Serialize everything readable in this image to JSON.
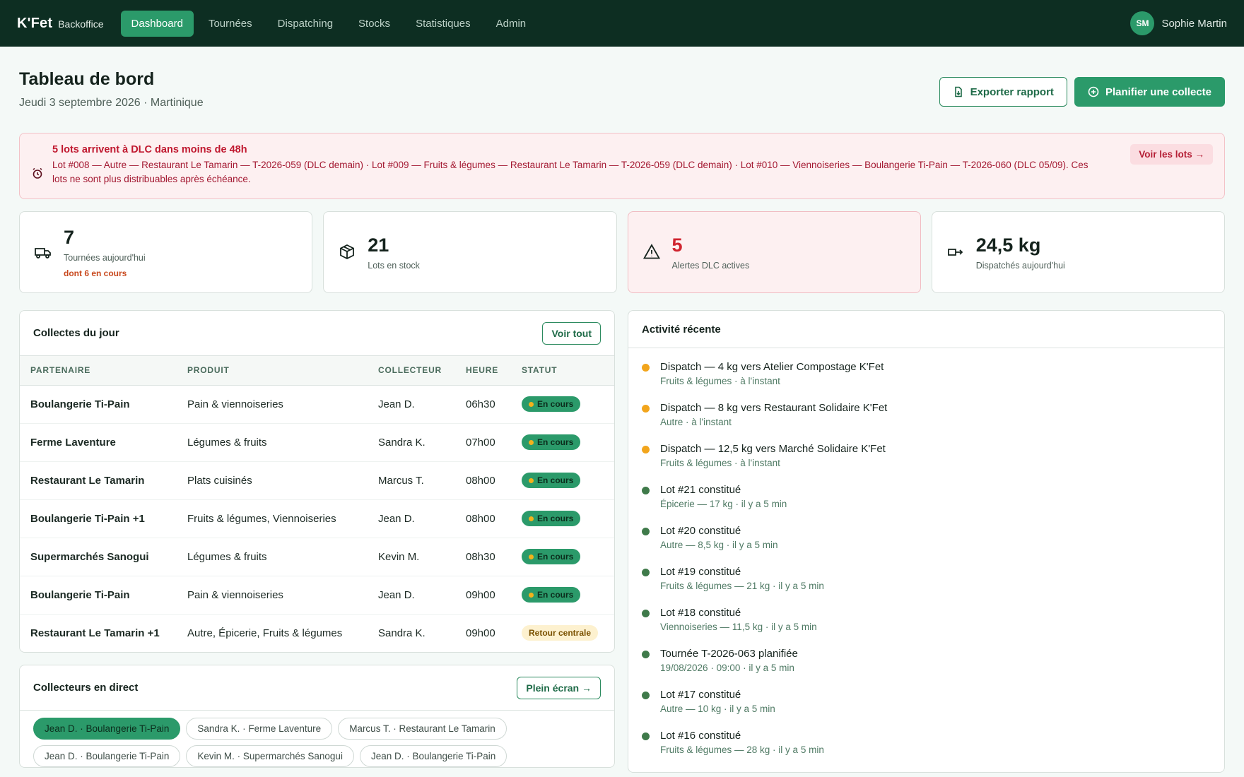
{
  "nav": {
    "brand": "K'Fet",
    "brand_sub": "Backoffice",
    "links": [
      "Dashboard",
      "Tournées",
      "Dispatching",
      "Stocks",
      "Statistiques",
      "Admin"
    ],
    "user_initials": "SM",
    "user_name": "Sophie Martin"
  },
  "header": {
    "title": "Tableau de bord",
    "subtitle": "Jeudi 3 septembre 2026 · Martinique",
    "export_label": "Exporter rapport",
    "plan_label": "Planifier une collecte"
  },
  "alert": {
    "title": "5 lots arrivent à DLC dans moins de 48h",
    "text": "Lot #008 — Autre — Restaurant Le Tamarin — T-2026-059 (DLC demain) · Lot #009 — Fruits & légumes — Restaurant Le Tamarin — T-2026-059 (DLC demain) · Lot #010 — Viennoiseries — Boulangerie Ti-Pain — T-2026-060 (DLC 05/09). Ces lots ne sont plus distribuables après échéance.",
    "link": "Voir les lots →"
  },
  "kpis": [
    {
      "value": "7",
      "label": "Tournées aujourd'hui",
      "note": "dont 6 en cours"
    },
    {
      "value": "21",
      "label": "Lots en stock"
    },
    {
      "value": "5",
      "label": "Alertes DLC actives"
    },
    {
      "value": "24,5 kg",
      "label": "Dispatchés aujourd'hui"
    }
  ],
  "collections": {
    "title": "Collectes du jour",
    "see_all": "Voir tout",
    "columns": [
      "PARTENAIRE",
      "PRODUIT",
      "COLLECTEUR",
      "HEURE",
      "STATUT"
    ],
    "rows": [
      {
        "partner": "Boulangerie Ti-Pain",
        "product": "Pain & viennoiseries",
        "collector": "Jean D.",
        "time": "06h30",
        "status": "En cours"
      },
      {
        "partner": "Ferme Laventure",
        "product": "Légumes & fruits",
        "collector": "Sandra K.",
        "time": "07h00",
        "status": "En cours"
      },
      {
        "partner": "Restaurant Le Tamarin",
        "product": "Plats cuisinés",
        "collector": "Marcus T.",
        "time": "08h00",
        "status": "En cours"
      },
      {
        "partner": "Boulangerie Ti-Pain +1",
        "product": "Fruits & légumes, Viennoiseries",
        "collector": "Jean D.",
        "time": "08h00",
        "status": "En cours"
      },
      {
        "partner": "Supermarchés Sanogui",
        "product": "Légumes & fruits",
        "collector": "Kevin M.",
        "time": "08h30",
        "status": "En cours"
      },
      {
        "partner": "Boulangerie Ti-Pain",
        "product": "Pain & viennoiseries",
        "collector": "Jean D.",
        "time": "09h00",
        "status": "En cours"
      },
      {
        "partner": "Restaurant Le Tamarin +1",
        "product": "Autre, Épicerie, Fruits & légumes",
        "collector": "Sandra K.",
        "time": "09h00",
        "status": "Retour centrale"
      }
    ]
  },
  "live": {
    "title": "Collecteurs en direct",
    "fullscreen": "Plein écran →",
    "chips": [
      "Jean D. · Boulangerie Ti-Pain",
      "Sandra K. · Ferme Laventure",
      "Marcus T. · Restaurant Le Tamarin",
      "Jean D. · Boulangerie Ti-Pain",
      "Kevin M. · Supermarchés Sanogui",
      "Jean D. · Boulangerie Ti-Pain"
    ]
  },
  "activity": {
    "title": "Activité récente",
    "items": [
      {
        "title": "Dispatch — 4 kg vers Atelier Compostage K'Fet",
        "sub": "Fruits & légumes · à l'instant",
        "color": "orange"
      },
      {
        "title": "Dispatch — 8 kg vers Restaurant Solidaire K'Fet",
        "sub": "Autre · à l'instant",
        "color": "orange"
      },
      {
        "title": "Dispatch — 12,5 kg vers Marché Solidaire K'Fet",
        "sub": "Fruits & légumes · à l'instant",
        "color": "orange"
      },
      {
        "title": "Lot #21 constitué",
        "sub": "Épicerie — 17 kg · il y a 5 min",
        "color": "green"
      },
      {
        "title": "Lot #20 constitué",
        "sub": "Autre — 8,5 kg · il y a 5 min",
        "color": "green"
      },
      {
        "title": "Lot #19 constitué",
        "sub": "Fruits & légumes — 21 kg · il y a 5 min",
        "color": "green"
      },
      {
        "title": "Lot #18 constitué",
        "sub": "Viennoiseries — 11,5 kg · il y a 5 min",
        "color": "green"
      },
      {
        "title": "Tournée T-2026-063 planifiée",
        "sub": "19/08/2026 · 09:00 · il y a 5 min",
        "color": "green"
      },
      {
        "title": "Lot #17 constitué",
        "sub": "Autre — 10 kg · il y a 5 min",
        "color": "green"
      },
      {
        "title": "Lot #16 constitué",
        "sub": "Fruits & légumes — 28 kg · il y a 5 min",
        "color": "green"
      }
    ]
  },
  "colors": {
    "nav_bg": "#0d2e22",
    "accent": "#2b9a6a",
    "danger": "#d0242f",
    "dot_orange": "#f2a51c",
    "dot_green": "#3f7a4a"
  }
}
